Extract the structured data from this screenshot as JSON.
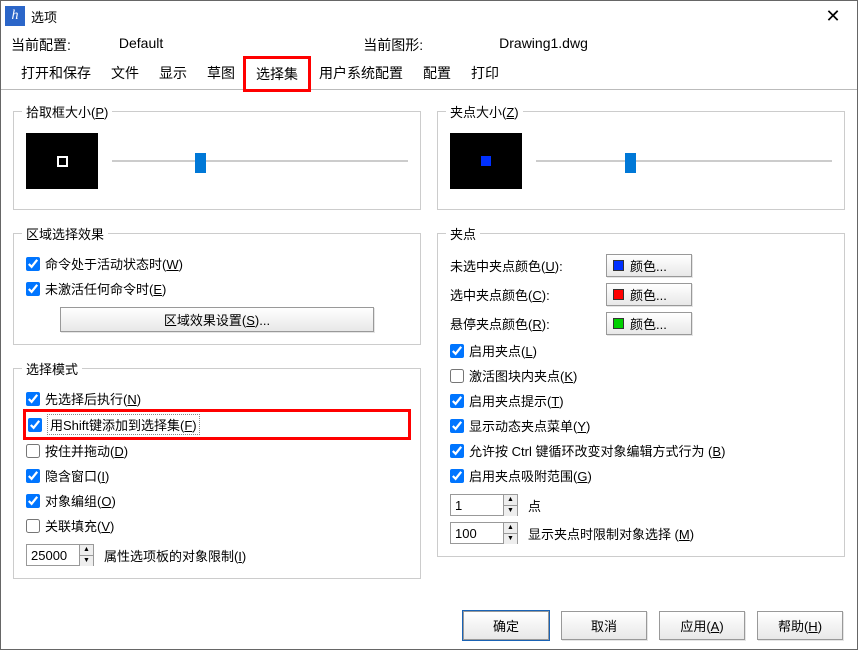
{
  "window": {
    "title": "选项"
  },
  "info": {
    "currentConfigLabel": "当前配置:",
    "currentConfigValue": "Default",
    "currentDrawingLabel": "当前图形:",
    "currentDrawingValue": "Drawing1.dwg"
  },
  "tabs": {
    "openSave": "打开和保存",
    "file": "文件",
    "display": "显示",
    "sketch": "草图",
    "selection": "选择集",
    "userSys": "用户系统配置",
    "config": "配置",
    "print": "打印"
  },
  "pickbox": {
    "legend": "拾取框大小(P)"
  },
  "gripSize": {
    "legend": "夹点大小(Z)"
  },
  "selViz": {
    "legend": "区域选择效果",
    "chkActiveCmd": "命令处于活动状态时(W)",
    "chkNoActive": "未激活任何命令时(E)",
    "btnSettings": "区域效果设置(S)..."
  },
  "selMode": {
    "legend": "选择模式",
    "chkNoun": "先选择后执行(N)",
    "chkShift": "用Shift键添加到选择集(F)",
    "chkPressDrag": "按住并拖动(D)",
    "chkImplWin": "隐含窗口(I)",
    "chkObjGroup": "对象编组(O)",
    "chkAssocHatch": "关联填充(V)",
    "limitValue": "25000",
    "limitLabel": "属性选项板的对象限制(I)"
  },
  "grips": {
    "legend": "夹点",
    "unselLabel": "未选中夹点颜色(U):",
    "selLabel": "选中夹点颜色(C):",
    "hoverLabel": "悬停夹点颜色(R):",
    "colorBtn": "颜色...",
    "chkEnable": "启用夹点(L)",
    "chkBlocks": "激活图块内夹点(K)",
    "chkTips": "启用夹点提示(T)",
    "chkDynMenu": "显示动态夹点菜单(Y)",
    "chkCtrlCycle": "允许按 Ctrl 键循环改变对象编辑方式行为 (B)",
    "chkSnapRange": "启用夹点吸附范围(G)",
    "snapValue": "1",
    "snapLabel": "点",
    "limitValue": "100",
    "limitLabel": "显示夹点时限制对象选择 (M)"
  },
  "colors": {
    "unsel": "#0030ff",
    "sel": "#ff0000",
    "hover": "#00d000"
  },
  "footer": {
    "ok": "确定",
    "cancel": "取消",
    "apply": "应用(A)",
    "help": "帮助(H)"
  }
}
